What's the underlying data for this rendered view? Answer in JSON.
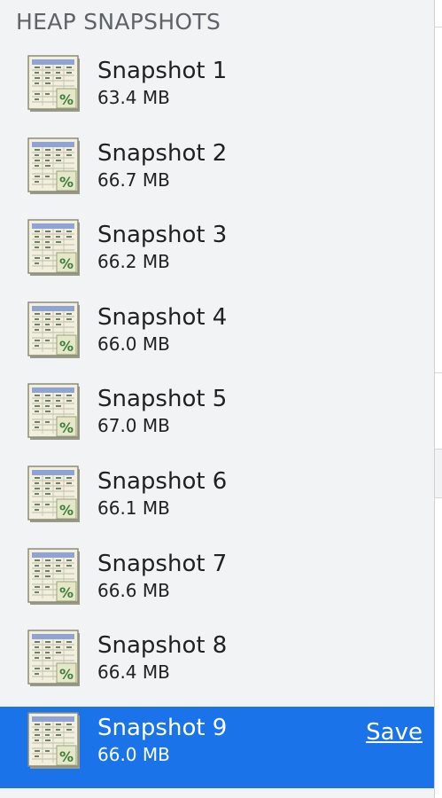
{
  "section": {
    "title": "HEAP SNAPSHOTS"
  },
  "snapshots": [
    {
      "name": "Snapshot 1",
      "size": "63.4 MB"
    },
    {
      "name": "Snapshot 2",
      "size": "66.7 MB"
    },
    {
      "name": "Snapshot 3",
      "size": "66.2 MB"
    },
    {
      "name": "Snapshot 4",
      "size": "66.0 MB"
    },
    {
      "name": "Snapshot 5",
      "size": "67.0 MB"
    },
    {
      "name": "Snapshot 6",
      "size": "66.1 MB"
    },
    {
      "name": "Snapshot 7",
      "size": "66.6 MB"
    },
    {
      "name": "Snapshot 8",
      "size": "66.4 MB"
    },
    {
      "name": "Snapshot 9",
      "size": "66.0 MB",
      "selected": true,
      "action": "Save"
    }
  ],
  "icon": "heap-snapshot-icon",
  "colors": {
    "panel_background": "#f1f3f4",
    "selected_background": "#1a73e8",
    "title_text": "#5f6368",
    "item_text": "#202124",
    "selected_text": "#ffffff"
  }
}
